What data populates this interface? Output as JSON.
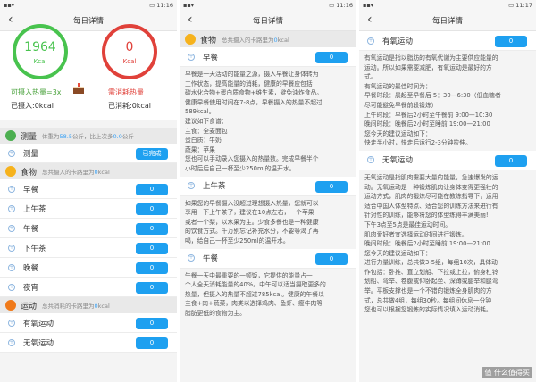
{
  "status": {
    "time_a": "11:16",
    "time_c": "11:17",
    "battery": "73"
  },
  "header": {
    "title": "每日详情",
    "back": "‹"
  },
  "p1": {
    "cal_left": {
      "value": "1964",
      "unit": "Kcal",
      "label": "可摄入热量=3x",
      "sub": "已摄入:0kcal"
    },
    "cal_right": {
      "value": "0",
      "unit": "Kcal",
      "label": "需消耗热量",
      "sub": "已消耗:0kcal"
    },
    "measure": {
      "title": "测量",
      "sub_pre": "体重为",
      "sub_val": "58.5",
      "sub_mid": "公斤，比上次多",
      "sub_val2": "0.0",
      "sub_post": "公斤"
    },
    "measure_row": {
      "label": "测量",
      "button": "已完成"
    },
    "food": {
      "title": "食物",
      "sub_pre": "总共摄入的卡路里为",
      "sub_val": "0",
      "sub_post": "kcal"
    },
    "meals": [
      {
        "label": "早餐",
        "value": "0"
      },
      {
        "label": "上午茶",
        "value": "0"
      },
      {
        "label": "午餐",
        "value": "0"
      },
      {
        "label": "下午茶",
        "value": "0"
      },
      {
        "label": "晚餐",
        "value": "0"
      },
      {
        "label": "夜宵",
        "value": "0"
      }
    ],
    "sport": {
      "title": "运动",
      "sub_pre": "总共消耗的卡路里为",
      "sub_val": "0",
      "sub_post": "kcal"
    },
    "sports": [
      {
        "label": "有氧运动",
        "value": "0"
      },
      {
        "label": "无氧运动",
        "value": "0"
      }
    ]
  },
  "p2": {
    "food": {
      "title": "食物",
      "sub_pre": "总共摄入的卡路里为",
      "sub_val": "0",
      "sub_post": "kcal"
    },
    "breakfast": {
      "label": "早餐",
      "value": "0",
      "lines": [
        "早餐是一天活动的能量之源，摄入早餐让身体转为",
        "工作状态，提高能量的消耗，健康的早餐应包括",
        "碳水化合物+蛋白质食物+维生素，避免油炸食品。",
        "健康早餐使用时间在7-8点，早餐摄入的热量不超过",
        "589kcal。",
        "建议如下食谱：",
        "主食：全麦面包",
        "蛋白质：牛奶",
        "蔬果：苹果",
        "您也可以手动录入您摄入的热量数。完成早餐半个",
        "小时后后自己一杯至少250ml的温开水。"
      ]
    },
    "tea": {
      "label": "上午茶",
      "value": "0",
      "lines": [
        "如果您的早餐摄入没超过理想摄入热量，您就可以",
        "享用一下上午茶了，建议在10点左右，一个苹果",
        "或者一个梨，以水果为主。少食多餐也是一种健康",
        "的饮食方式。千万别忘记补充水分，不要等渴了再",
        "喝，给自己一杯至少250ml的温开水。"
      ]
    },
    "lunch": {
      "label": "午餐",
      "value": "0",
      "lines": [
        "午餐一天中最重要的一顿饭，它提供的能量占一",
        "个人全天消耗能量的40%。中午可以适当摄取更多的",
        "热量，但摄入的热量不超过785kcal。健康的午餐以",
        "主食+肉+蔬菜，肉类以选择鸡肉、鱼虾、瘦牛肉等",
        "脂肪更低的食物为主。"
      ]
    }
  },
  "p3": {
    "aerobic": {
      "label": "有氧运动",
      "value": "0",
      "lines": [
        "有氧运动是指以脂肪的有氧代谢为主要供应能量的",
        "运动。所以如果需要减肥，有氧运动是最好的方",
        "式。",
        "有氧运动的最佳时间为：",
        "早餐时段：晨起至早餐后 5：30—6:30（低血糖者",
        "尽可能避免早餐前段锻炼）",
        "上午时段：早餐后2小时至午餐前 9:00—10:30",
        "晚间时段：晚餐后2小时至睡前 19:00—21:00",
        "您今天的建议运动如下：",
        "快走半小时，快走后运行2-3分钟拉伸。"
      ]
    },
    "anaerobic": {
      "label": "无氧运动",
      "value": "0",
      "lines": [
        "无氧运动是指肌肉需要大量的能量，急速爆发的运",
        "动。无氧运动是一种锻炼肌肉让身体变得更强壮的",
        "运动方式，肌肉的锻炼尽可能在教练指导下，运用",
        "适合中国人体型特点、适合您的训练方法来进行有",
        "针对性的训练，能够将您的体型练得丰满美丽!",
        "下午3点至5点是最佳运动时间。",
        "肌肉爱好者宜选择运动时间进行锻炼。",
        "晚间时段：晚餐后2小时至睡前 19:00—21:00",
        "您今天的建议运动如下：",
        "进行力量训练，总共做3-5组，每组10次，具体动",
        "作包括：卧推、直立划船、下拉或上拉，俯身杠铃",
        "划船、弯举、卷腹或仰卧起坐、深蹲或腿举和腿弯",
        "举。平板支撑也是一个不错的锻炼全身肌肉的方",
        "式，总共做4组，每组30秒。每组间休息一分钟",
        "您也可以根据您锻炼的实际情况填入运动消耗。"
      ]
    },
    "watermark": "值 什么值得买"
  }
}
